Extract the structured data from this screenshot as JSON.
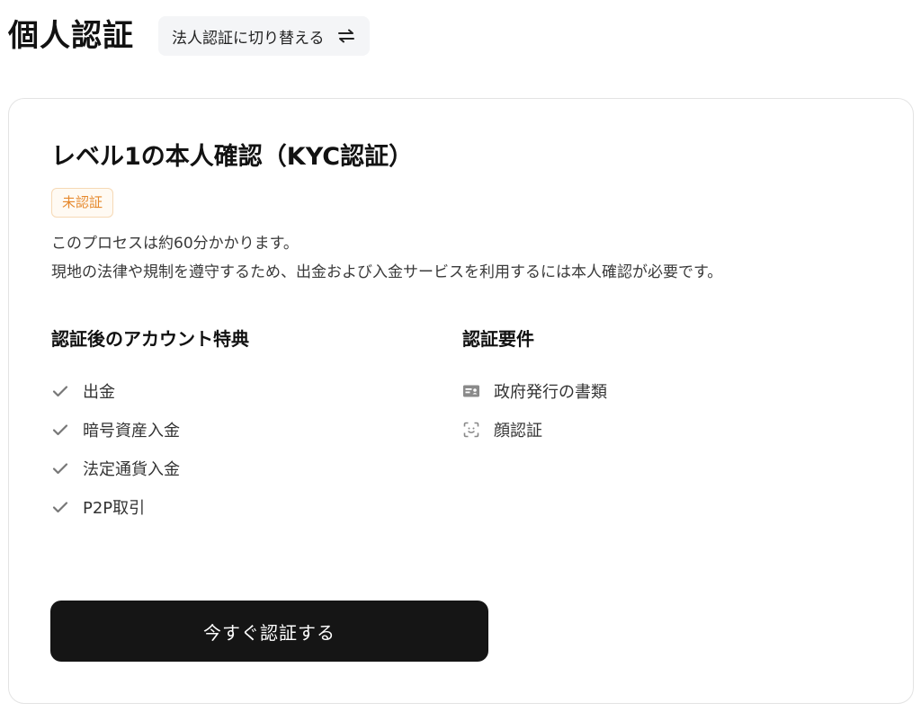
{
  "header": {
    "title": "個人認証",
    "switch_label": "法人認証に切り替える"
  },
  "card": {
    "title": "レベル1の本人確認（KYC認証）",
    "status": "未認証",
    "description": [
      "このプロセスは約60分かかります。",
      "現地の法律や規制を遵守するため、出金および入金サービスを利用するには本人確認が必要です。"
    ],
    "benefits": {
      "heading": "認証後のアカウント特典",
      "items": [
        {
          "label": "出金",
          "icon": "check-icon"
        },
        {
          "label": "暗号資産入金",
          "icon": "check-icon"
        },
        {
          "label": "法定通貨入金",
          "icon": "check-icon"
        },
        {
          "label": "P2P取引",
          "icon": "check-icon"
        }
      ]
    },
    "requirements": {
      "heading": "認証要件",
      "items": [
        {
          "label": "政府発行の書類",
          "icon": "id-card-icon"
        },
        {
          "label": "顔認証",
          "icon": "face-scan-icon"
        }
      ]
    },
    "cta_label": "今すぐ認証する"
  },
  "colors": {
    "badge_text": "#e6892e",
    "badge_border": "#f6d9b5",
    "button_bg": "#151515"
  }
}
